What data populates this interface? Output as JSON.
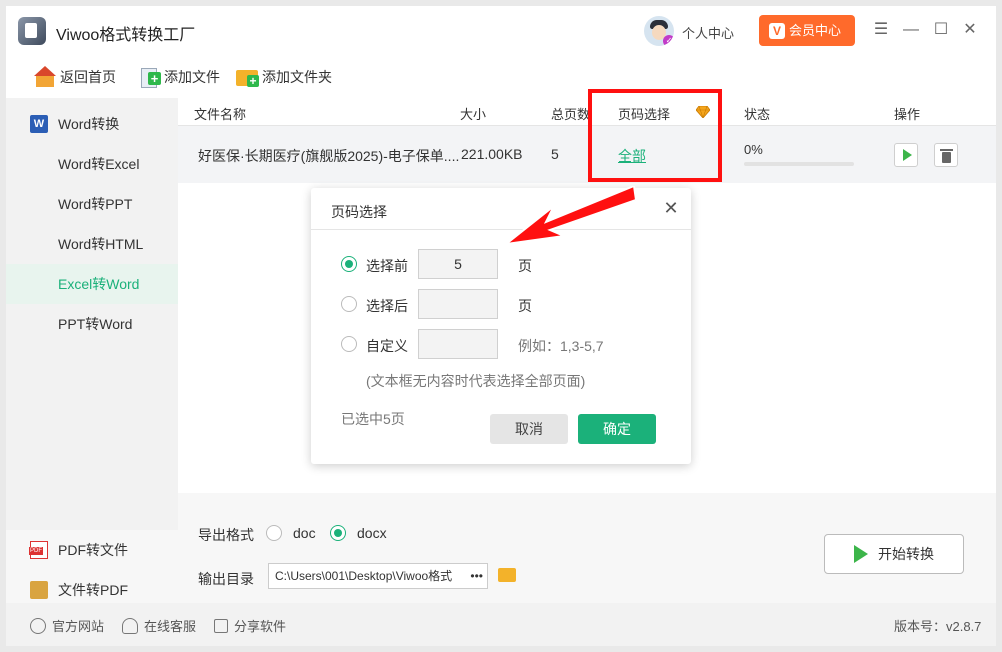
{
  "app": {
    "title": "Viwoo格式转换工厂",
    "user_center": "个人中心",
    "vip": "会员中心",
    "version": "版本号：v2.8.7"
  },
  "window_controls": {
    "menu": "☰",
    "minimize": "—",
    "maximize": "☐",
    "close": "✕"
  },
  "toolbar": {
    "home": "返回首页",
    "add_file": "添加文件",
    "add_folder": "添加文件夹"
  },
  "sidebar": {
    "group": "Word转换",
    "items": [
      "Word转Excel",
      "Word转PPT",
      "Word转HTML",
      "Excel转Word",
      "PPT转Word"
    ],
    "active": "Excel转Word",
    "bottom": [
      "PDF转文件",
      "文件转PDF"
    ]
  },
  "table": {
    "headers": {
      "name": "文件名称",
      "size": "大小",
      "pages": "总页数",
      "page_select": "页码选择",
      "status": "状态",
      "action": "操作"
    },
    "rows": [
      {
        "name": "好医保·长期医疗(旗舰版2025)-电子保单....",
        "size": "221.00KB",
        "pages": "5",
        "page_select": "全部",
        "status": "0%",
        "progress": 0
      }
    ]
  },
  "settings": {
    "export_label": "导出格式",
    "formats": [
      "doc",
      "docx"
    ],
    "selected_format": "docx",
    "output_label": "输出目录",
    "output_path": "C:\\Users\\001\\Desktop\\Viwoo格式",
    "output_more": "•••",
    "start_button": "开始转换"
  },
  "footer": {
    "site": "官方网站",
    "support": "在线客服",
    "share": "分享软件"
  },
  "dialog": {
    "title": "页码选择",
    "close": "✕",
    "options": [
      {
        "label": "选择前",
        "value": "5",
        "suffix": "页",
        "checked": true
      },
      {
        "label": "选择后",
        "value": "",
        "suffix": "页",
        "checked": false
      },
      {
        "label": "自定义",
        "value": "",
        "suffix": "例如：1,3-5,7",
        "checked": false
      }
    ],
    "note": "(文本框无内容时代表选择全部页面)",
    "selected_info": "已选中5页",
    "cancel": "取消",
    "ok": "确定"
  },
  "colors": {
    "accent": "#1bb17a",
    "vip": "#ff6a2b",
    "highlight": "#ff1010"
  }
}
